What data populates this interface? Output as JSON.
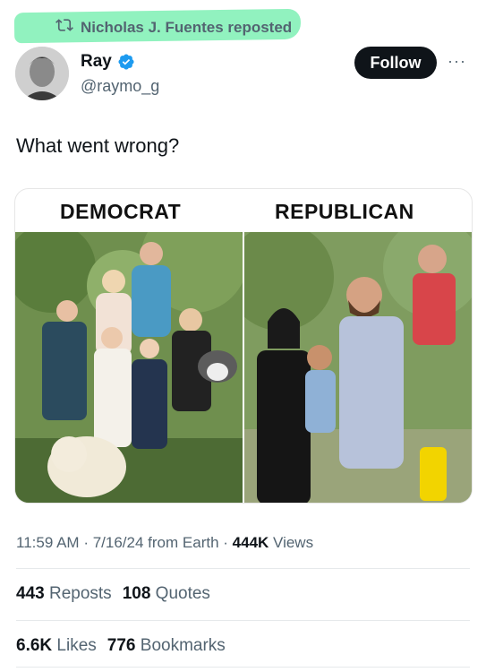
{
  "repost": {
    "text": "Nicholas J. Fuentes reposted",
    "icon": "repost-icon"
  },
  "author": {
    "name": "Ray",
    "handle": "@raymo_g",
    "verified": true,
    "verified_color": "#1d9bf0"
  },
  "follow_label": "Follow",
  "more_label": "···",
  "tweet": {
    "text": "What went wrong?"
  },
  "media": {
    "left_label": "DEMOCRAT",
    "right_label": "REPUBLICAN"
  },
  "meta": {
    "time": "11:59 AM",
    "date": "7/16/24",
    "source": "from Earth",
    "views_count": "444K",
    "views_label": "Views"
  },
  "stats": {
    "reposts_count": "443",
    "reposts_label": "Reposts",
    "quotes_count": "108",
    "quotes_label": "Quotes",
    "likes_count": "6.6K",
    "likes_label": "Likes",
    "bookmarks_count": "776",
    "bookmarks_label": "Bookmarks"
  },
  "colors": {
    "highlight": "#7ef0b4",
    "secondary_text": "#536471",
    "primary_text": "#0f1419"
  }
}
